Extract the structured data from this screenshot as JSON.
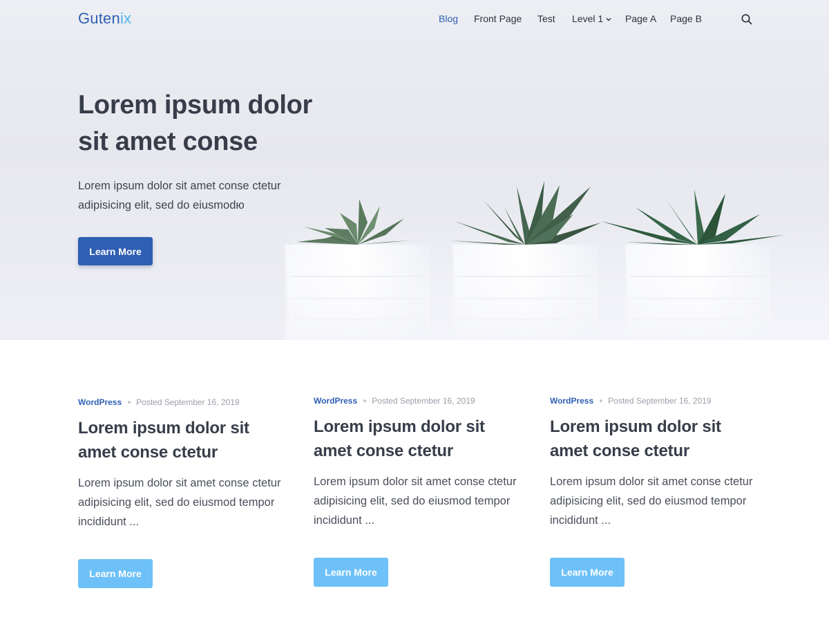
{
  "header": {
    "logo_main": "Guten",
    "logo_accent": "ix",
    "nav": [
      "Blog",
      "Front Page",
      "Test",
      "Level 1",
      "Page A",
      "Page B"
    ],
    "active_nav": "Blog",
    "search_icon": "search-icon"
  },
  "hero": {
    "title": "Lorem ipsum dolor sit amet conse",
    "subtitle": "Lorem ipsum dolor sit amet conse ctetur adipisicing elit, sed do eiusmodю",
    "button_label": "Learn More"
  },
  "posts": [
    {
      "category": "WordPress",
      "date": "Posted September 16, 2019",
      "title": "Lorem ipsum dolor sit amet conse ctetur",
      "excerpt": "Lorem ipsum dolor sit amet conse ctetur adipisicing elit, sed do eiusmod tempor incididunt ...",
      "button_label": "Learn More"
    },
    {
      "category": "WordPress",
      "date": "Posted September 16, 2019",
      "title": "Lorem ipsum dolor sit amet conse ctetur",
      "excerpt": "Lorem ipsum dolor sit amet conse ctetur adipisicing elit, sed do eiusmod tempor incididunt ...",
      "button_label": "Learn More"
    },
    {
      "category": "WordPress",
      "date": "Posted September 16, 2019",
      "title": "Lorem ipsum dolor sit amet conse ctetur",
      "excerpt": "Lorem ipsum dolor sit amet conse ctetur adipisicing elit, sed do eiusmod tempor incididunt ...",
      "button_label": "Learn More"
    }
  ],
  "colors": {
    "brand": "#2f5fb3",
    "brand_accent": "#4fb4f0",
    "button_light": "#6ec1f8",
    "text_dark": "#383d4a",
    "meta_gray": "#9a9ea8"
  }
}
